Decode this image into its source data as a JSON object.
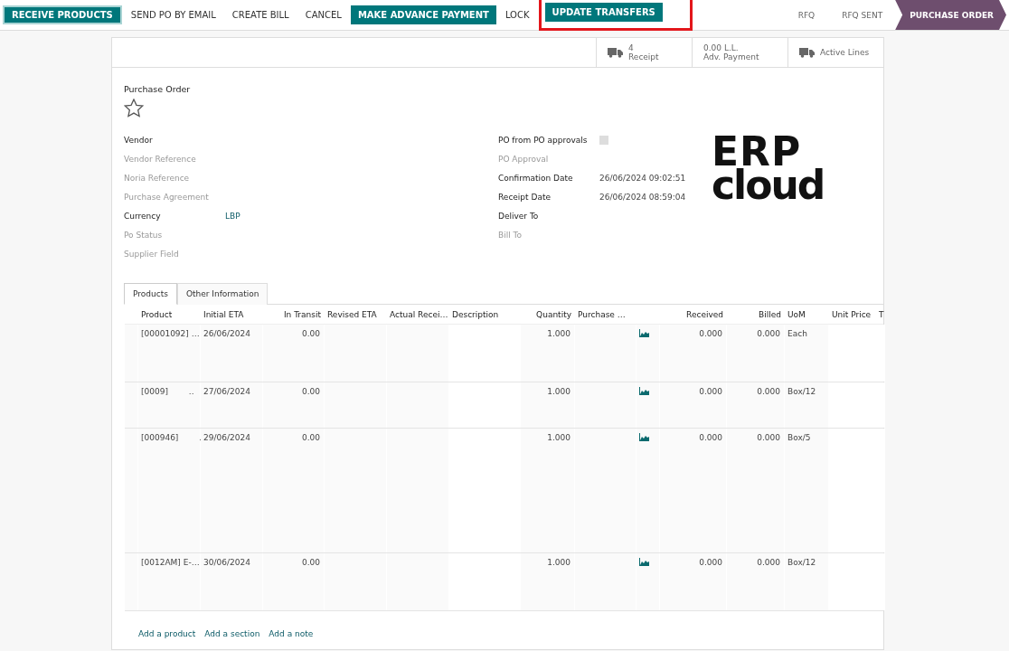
{
  "toolbar": {
    "buttons": [
      {
        "label": "RECEIVE PRODUCTS",
        "kind": "primary",
        "highlighted": false,
        "focused": true
      },
      {
        "label": "SEND PO BY EMAIL",
        "kind": "plain",
        "highlighted": false,
        "focused": false
      },
      {
        "label": "CREATE BILL",
        "kind": "plain",
        "highlighted": false,
        "focused": false
      },
      {
        "label": "CANCEL",
        "kind": "plain",
        "highlighted": false,
        "focused": false
      },
      {
        "label": "MAKE ADVANCE PAYMENT",
        "kind": "primary",
        "highlighted": false,
        "focused": false
      },
      {
        "label": "LOCK",
        "kind": "plain",
        "highlighted": false,
        "focused": false
      },
      {
        "label": "UPDATE TRANSFERS",
        "kind": "primary",
        "highlighted": true,
        "focused": false
      }
    ],
    "stages": [
      {
        "label": "RFQ",
        "selected": false
      },
      {
        "label": "RFQ SENT",
        "selected": false
      },
      {
        "label": "PURCHASE ORDER",
        "selected": true
      }
    ]
  },
  "stat_buttons": [
    {
      "value": "4",
      "label": "Receipt",
      "kind": "transfer"
    },
    {
      "value": "0.00 L.L.",
      "label": "Adv. Payment",
      "kind": "payment"
    },
    {
      "label": "Active Lines",
      "kind": "transfer"
    }
  ],
  "title": "Purchase Order",
  "favorite": false,
  "left_fields": [
    {
      "label": "Vendor",
      "required": true
    },
    {
      "label": "Vendor Reference",
      "required": false
    },
    {
      "label": "Noria Reference",
      "required": false
    },
    {
      "label": "Purchase Agreement",
      "required": false
    },
    {
      "label": "Currency",
      "value": "LBP",
      "required": true
    },
    {
      "label": "Po Status",
      "required": false
    },
    {
      "label": "Supplier Field",
      "required": false
    }
  ],
  "right_fields": [
    {
      "label": "PO from PO approvals",
      "kind": "checkbox",
      "checked": false,
      "required": true
    },
    {
      "label": "PO Approval",
      "kind": "text",
      "required": false
    },
    {
      "label": "Confirmation Date",
      "kind": "text",
      "value": "26/06/2024 09:02:51",
      "required": true
    },
    {
      "label": "Receipt Date",
      "kind": "text",
      "value": "26/06/2024 08:59:04",
      "required": true
    },
    {
      "label": "Deliver To",
      "kind": "text",
      "required": true
    },
    {
      "label": "Bill To",
      "kind": "text",
      "required": false
    }
  ],
  "logo": {
    "top": "ERP",
    "bottom": "cloud"
  },
  "tabs": [
    {
      "label": "Products",
      "selected": true
    },
    {
      "label": "Other Information",
      "selected": false
    }
  ],
  "table": {
    "columns": [
      "Product",
      "Initial ETA",
      "In Transit",
      "Revised ETA",
      "Actual Recei…",
      "Description",
      "Quantity",
      "Purchase …",
      "",
      "Received",
      "Billed",
      "UoM",
      "Unit Price",
      "T"
    ],
    "rows": [
      {
        "product": "[00001092] …",
        "initial_eta": "26/06/2024",
        "in_transit": "0.00",
        "quantity": "1.000",
        "received": "0.000",
        "billed": "0.000",
        "uom": "Each"
      },
      {
        "product": "[0009]        ..",
        "initial_eta": "27/06/2024",
        "in_transit": "0.00",
        "quantity": "1.000",
        "received": "0.000",
        "billed": "0.000",
        "uom": "Box/12"
      },
      {
        "product": "[000946]        .",
        "initial_eta": "29/06/2024",
        "in_transit": "0.00",
        "quantity": "1.000",
        "received": "0.000",
        "billed": "0.000",
        "uom": "Box/5"
      },
      {
        "product": "[0012AM] E-…",
        "initial_eta": "30/06/2024",
        "in_transit": "0.00",
        "quantity": "1.000",
        "received": "0.000",
        "billed": "0.000",
        "uom": "Box/12"
      }
    ]
  },
  "add_links": [
    "Add a product",
    "Add a section",
    "Add a note"
  ]
}
